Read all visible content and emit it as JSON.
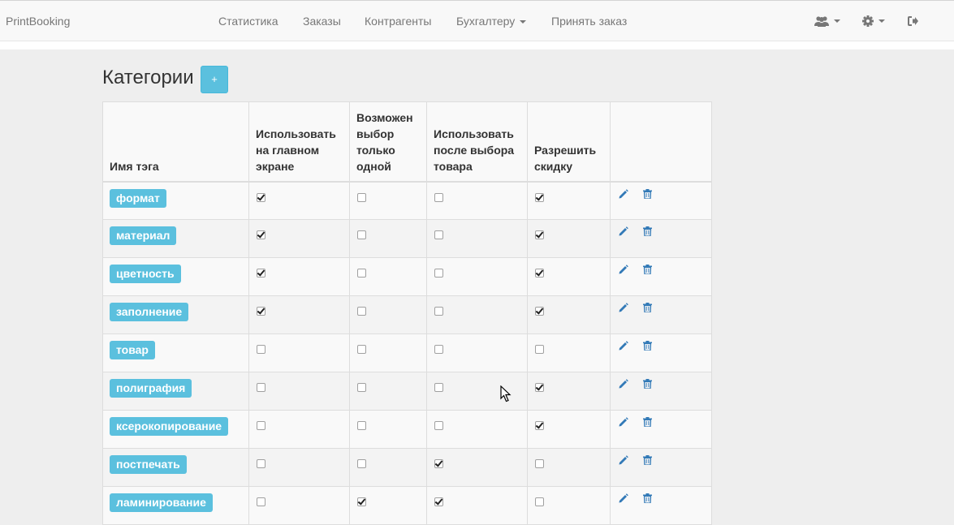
{
  "brand": "PrintBooking",
  "nav": {
    "statistics": "Статистика",
    "orders": "Заказы",
    "contractors": "Контрагенты",
    "accounting": "Бухгалтеру",
    "accept_order": "Принять заказ"
  },
  "icons": {
    "users": "users-icon",
    "settings": "gear-icon",
    "logout": "sign-out-icon",
    "edit": "pencil-icon",
    "delete": "trash-icon"
  },
  "colors": {
    "accent": "#5bc0de",
    "link": "#337ab7"
  },
  "page": {
    "title": "Категории",
    "add_button": "+"
  },
  "table": {
    "headers": [
      "Имя тэга",
      "Использовать на главном экране",
      "Возможен выбор только одной",
      "Использовать после выбора товара",
      "Разрешить скидку",
      ""
    ],
    "rows": [
      {
        "name": "формат",
        "main": true,
        "single": false,
        "after": false,
        "discount": true
      },
      {
        "name": "материал",
        "main": true,
        "single": false,
        "after": false,
        "discount": true
      },
      {
        "name": "цветность",
        "main": true,
        "single": false,
        "after": false,
        "discount": true
      },
      {
        "name": "заполнение",
        "main": true,
        "single": false,
        "after": false,
        "discount": true
      },
      {
        "name": "товар",
        "main": false,
        "single": false,
        "after": false,
        "discount": false
      },
      {
        "name": "полиграфия",
        "main": false,
        "single": false,
        "after": false,
        "discount": true
      },
      {
        "name": "ксерокопирование",
        "main": false,
        "single": false,
        "after": false,
        "discount": true
      },
      {
        "name": "постпечать",
        "main": false,
        "single": false,
        "after": true,
        "discount": false
      },
      {
        "name": "ламинирование",
        "main": false,
        "single": true,
        "after": true,
        "discount": false
      }
    ]
  }
}
